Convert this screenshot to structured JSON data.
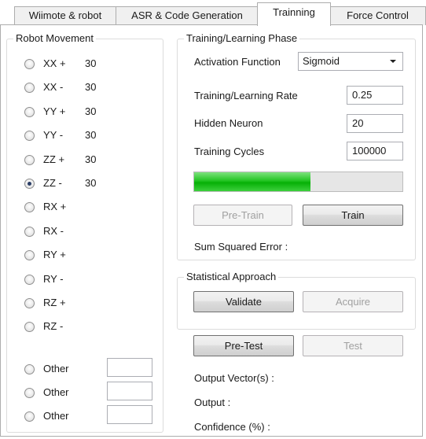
{
  "tabs": [
    {
      "label": "Wiimote & robot"
    },
    {
      "label": "ASR & Code Generation"
    },
    {
      "label": "Trainning",
      "active": true
    },
    {
      "label": "Force Control"
    }
  ],
  "robot_movement": {
    "title": "Robot Movement",
    "items": [
      {
        "label": "XX +",
        "value": "30",
        "checked": false
      },
      {
        "label": "XX -",
        "value": "30",
        "checked": false
      },
      {
        "label": "YY +",
        "value": "30",
        "checked": false
      },
      {
        "label": "YY -",
        "value": "30",
        "checked": false
      },
      {
        "label": "ZZ +",
        "value": "30",
        "checked": false
      },
      {
        "label": "ZZ -",
        "value": "30",
        "checked": true
      },
      {
        "label": "RX +",
        "value": "",
        "checked": false
      },
      {
        "label": "RX -",
        "value": "",
        "checked": false
      },
      {
        "label": "RY +",
        "value": "",
        "checked": false
      },
      {
        "label": "RY -",
        "value": "",
        "checked": false
      },
      {
        "label": "RZ +",
        "value": "",
        "checked": false
      },
      {
        "label": "RZ -",
        "value": "",
        "checked": false
      }
    ],
    "others": [
      {
        "label": "Other",
        "value": ""
      },
      {
        "label": "Other",
        "value": ""
      },
      {
        "label": "Other",
        "value": ""
      }
    ]
  },
  "training": {
    "title": "Training/Learning Phase",
    "activation_label": "Activation Function",
    "activation_value": "Sigmoid",
    "rate_label": "Training/Learning Rate",
    "rate_value": "0.25",
    "hidden_label": "Hidden Neuron",
    "hidden_value": "20",
    "cycles_label": "Training Cycles",
    "cycles_value": "100000",
    "progress": 0.56,
    "pretrain_label": "Pre-Train",
    "train_label": "Train",
    "sse_label": "Sum Squared Error :"
  },
  "statistical": {
    "title": "Statistical Approach",
    "validate_label": "Validate",
    "acquire_label": "Acquire"
  },
  "testing": {
    "pretest_label": "Pre-Test",
    "test_label": "Test",
    "output_vectors_label": "Output Vector(s) :",
    "output_label": "Output :",
    "confidence_label": "Confidence (%) :"
  }
}
